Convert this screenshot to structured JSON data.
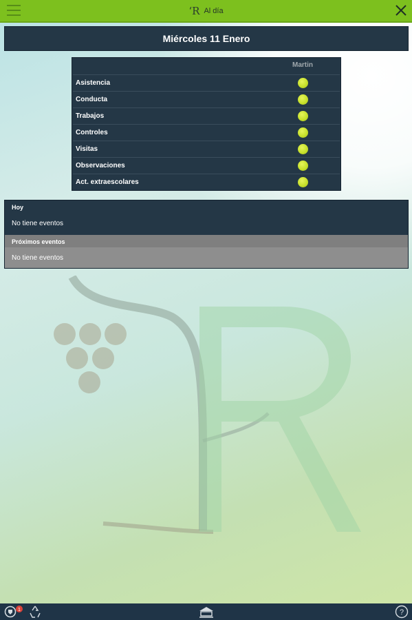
{
  "header": {
    "logo": "ʻR",
    "title": "Al día",
    "menu_icon": "hamburger-icon",
    "close_icon": "close-icon"
  },
  "date": "Miércoles 11 Enero",
  "summary": {
    "student": "Martin",
    "rows": [
      {
        "label": "Asistencia",
        "status": "ok"
      },
      {
        "label": "Conducta",
        "status": "ok"
      },
      {
        "label": "Trabajos",
        "status": "ok"
      },
      {
        "label": "Controles",
        "status": "ok"
      },
      {
        "label": "Visitas",
        "status": "ok"
      },
      {
        "label": "Observaciones",
        "status": "ok"
      },
      {
        "label": "Act. extraescolares",
        "status": "ok"
      }
    ],
    "status_color": "#c7e12c"
  },
  "events": {
    "today_title": "Hoy",
    "today_text": "No tiene eventos",
    "upcoming_title": "Próximos eventos",
    "upcoming_text": "No tiene eventos"
  },
  "footer": {
    "badge": "1",
    "icons": [
      "notification-icon",
      "recycle-icon",
      "school-icon",
      "help-icon"
    ]
  },
  "colors": {
    "topbar": "#7dc01e",
    "panel": "#243746",
    "grey_panel": "#8e8e8e",
    "bottombar": "#1f3447"
  }
}
